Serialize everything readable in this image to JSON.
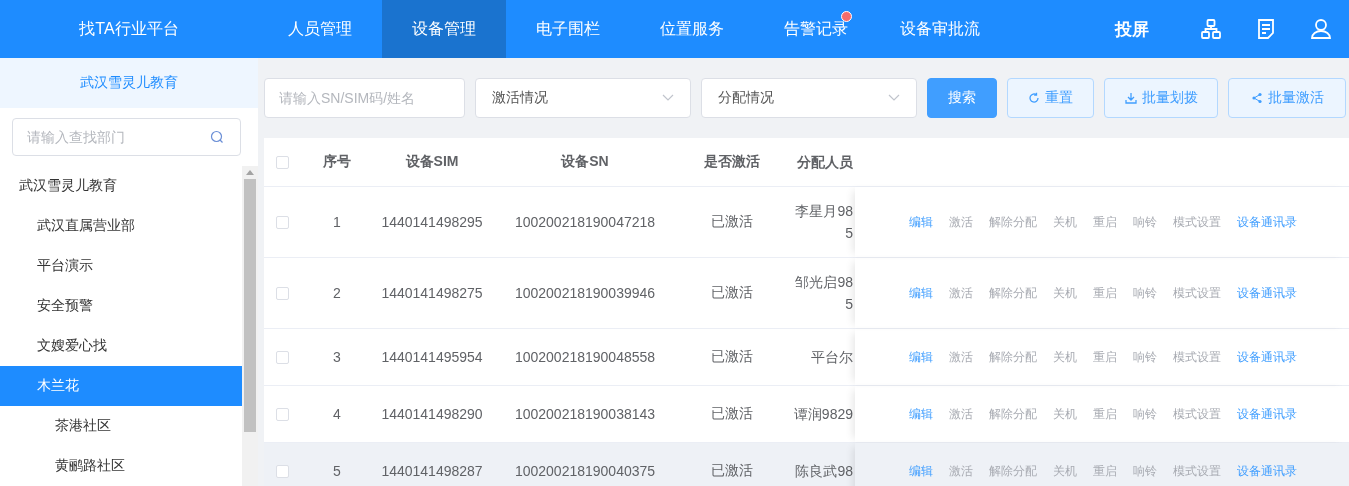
{
  "header": {
    "brand": "找TA行业平台",
    "nav": [
      {
        "label": "人员管理",
        "selected": false,
        "badge": false
      },
      {
        "label": "设备管理",
        "selected": true,
        "badge": false
      },
      {
        "label": "电子围栏",
        "selected": false,
        "badge": false
      },
      {
        "label": "位置服务",
        "selected": false,
        "badge": false
      },
      {
        "label": "告警记录",
        "selected": false,
        "badge": true
      },
      {
        "label": "设备审批流",
        "selected": false,
        "badge": false
      }
    ],
    "cast_label": "投屏"
  },
  "sidebar": {
    "title": "武汉雪灵儿教育",
    "search": {
      "placeholder": "请输入查找部门"
    },
    "tree": [
      {
        "label": "武汉雪灵儿教育",
        "selected": false,
        "children": [
          {
            "label": "武汉直属营业部",
            "selected": false
          },
          {
            "label": "平台演示",
            "selected": false
          },
          {
            "label": "安全预警",
            "selected": false
          },
          {
            "label": "文嫂爱心找",
            "selected": false
          },
          {
            "label": "木兰花",
            "selected": true,
            "children": [
              {
                "label": "茶港社区",
                "selected": false
              },
              {
                "label": "黄鹂路社区",
                "selected": false
              }
            ]
          }
        ]
      }
    ]
  },
  "filters": {
    "search": {
      "placeholder": "请输入SN/SIM码/姓名"
    },
    "selects": [
      {
        "placeholder": "激活情况"
      },
      {
        "placeholder": "分配情况"
      }
    ],
    "buttons": [
      {
        "label": "搜索",
        "kind": "primary"
      },
      {
        "label": "重置",
        "kind": "reset"
      },
      {
        "label": "批量划拨",
        "kind": "transfer"
      },
      {
        "label": "批量激活",
        "kind": "activate"
      }
    ]
  },
  "table": {
    "select_all_checked": false,
    "columns": [
      "序号",
      "设备SIM",
      "设备SN",
      "是否激活",
      "分配人员"
    ],
    "rows": [
      {
        "checked": false,
        "index": "1",
        "sim": "1440141498295",
        "sn": "100200218190047218",
        "activated": "已激活",
        "person": [
          "李星月98",
          "5"
        ],
        "hovered": false,
        "actions": [
          {
            "label": "编辑",
            "disabled": false
          },
          {
            "label": "激活",
            "disabled": true
          },
          {
            "label": "解除分配",
            "disabled": true
          },
          {
            "label": "关机",
            "disabled": true
          },
          {
            "label": "重启",
            "disabled": true
          },
          {
            "label": "响铃",
            "disabled": true
          },
          {
            "label": "模式设置",
            "disabled": true
          },
          {
            "label": "设备通讯录",
            "disabled": false
          }
        ]
      },
      {
        "checked": false,
        "index": "2",
        "sim": "1440141498275",
        "sn": "100200218190039946",
        "activated": "已激活",
        "person": [
          "邹光启98",
          "5"
        ],
        "hovered": false,
        "actions": [
          {
            "label": "编辑",
            "disabled": false
          },
          {
            "label": "激活",
            "disabled": true
          },
          {
            "label": "解除分配",
            "disabled": true
          },
          {
            "label": "关机",
            "disabled": true
          },
          {
            "label": "重启",
            "disabled": true
          },
          {
            "label": "响铃",
            "disabled": true
          },
          {
            "label": "模式设置",
            "disabled": true
          },
          {
            "label": "设备通讯录",
            "disabled": false
          }
        ]
      },
      {
        "checked": false,
        "index": "3",
        "sim": "1440141495954",
        "sn": "100200218190048558",
        "activated": "已激活",
        "person": [
          "平台尔"
        ],
        "hovered": false,
        "actions": [
          {
            "label": "编辑",
            "disabled": false
          },
          {
            "label": "激活",
            "disabled": true
          },
          {
            "label": "解除分配",
            "disabled": true
          },
          {
            "label": "关机",
            "disabled": true
          },
          {
            "label": "重启",
            "disabled": true
          },
          {
            "label": "响铃",
            "disabled": true
          },
          {
            "label": "模式设置",
            "disabled": true
          },
          {
            "label": "设备通讯录",
            "disabled": false
          }
        ]
      },
      {
        "checked": false,
        "index": "4",
        "sim": "1440141498290",
        "sn": "100200218190038143",
        "activated": "已激活",
        "person": [
          "谭润9829"
        ],
        "hovered": false,
        "actions": [
          {
            "label": "编辑",
            "disabled": false
          },
          {
            "label": "激活",
            "disabled": true
          },
          {
            "label": "解除分配",
            "disabled": true
          },
          {
            "label": "关机",
            "disabled": true
          },
          {
            "label": "重启",
            "disabled": true
          },
          {
            "label": "响铃",
            "disabled": true
          },
          {
            "label": "模式设置",
            "disabled": true
          },
          {
            "label": "设备通讯录",
            "disabled": false
          }
        ]
      },
      {
        "checked": false,
        "index": "5",
        "sim": "1440141498287",
        "sn": "100200218190040375",
        "activated": "已激活",
        "person": [
          "陈良武98"
        ],
        "hovered": true,
        "actions": [
          {
            "label": "编辑",
            "disabled": false
          },
          {
            "label": "激活",
            "disabled": true
          },
          {
            "label": "解除分配",
            "disabled": true
          },
          {
            "label": "关机",
            "disabled": true
          },
          {
            "label": "重启",
            "disabled": true
          },
          {
            "label": "响铃",
            "disabled": true
          },
          {
            "label": "模式设置",
            "disabled": true
          },
          {
            "label": "设备通讯录",
            "disabled": false
          }
        ]
      }
    ]
  }
}
